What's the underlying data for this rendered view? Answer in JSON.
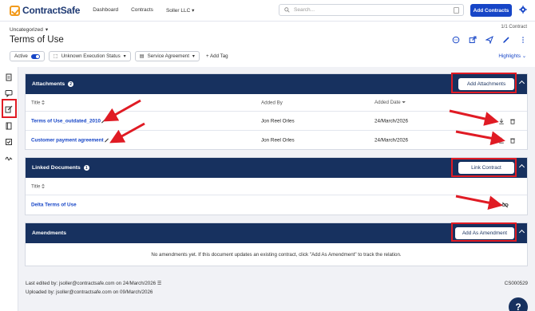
{
  "app": {
    "name": "ContractSafe"
  },
  "nav": {
    "dashboard": "Dashboard",
    "contracts": "Contracts",
    "org": "Soller LLC"
  },
  "search": {
    "placeholder": "Search..."
  },
  "header": {
    "add_contracts": "Add Contracts",
    "folder": "Uncategorized",
    "count": "1/1 Contract",
    "title": "Terms of Use"
  },
  "tags": {
    "status": "Active",
    "execution": "Unknown Execution Status",
    "type": "Service Agreement",
    "add_tag": "+ Add Tag",
    "highlights": "Highlights"
  },
  "attachments": {
    "title": "Attachments",
    "count": "2",
    "button": "Add Attachments",
    "columns": {
      "title": "Title",
      "added_by": "Added By",
      "added_date": "Added Date"
    },
    "rows": [
      {
        "title": "Terms of Use_outdated_2010",
        "added_by": "Jon Reel Orles",
        "added_date": "24/March/2026"
      },
      {
        "title": "Customer payment agreement",
        "added_by": "Jon Reel Orles",
        "added_date": "24/March/2026"
      }
    ]
  },
  "linked": {
    "title": "Linked Documents",
    "count": "1",
    "button": "Link Contract",
    "column_title": "Title",
    "rows": [
      {
        "title": "Delta Terms of Use"
      }
    ]
  },
  "amendments": {
    "title": "Amendments",
    "button": "Add As Amendment",
    "empty": "No amendments yet. If this document updates an existing contract, click \"Add As Amendment\" to track the relation."
  },
  "footer": {
    "last_edited": "Last edited by: jsoller@contractsafe.com on 24/March/2026",
    "uploaded": "Uploaded by: jsoller@contractsafe.com on 09/March/2026",
    "id": "CS000529"
  },
  "help": "?",
  "colors": {
    "navy": "#17315f",
    "brand_blue": "#1746c7",
    "annotation_red": "#e01b24",
    "logo_orange": "#f29b1d"
  }
}
